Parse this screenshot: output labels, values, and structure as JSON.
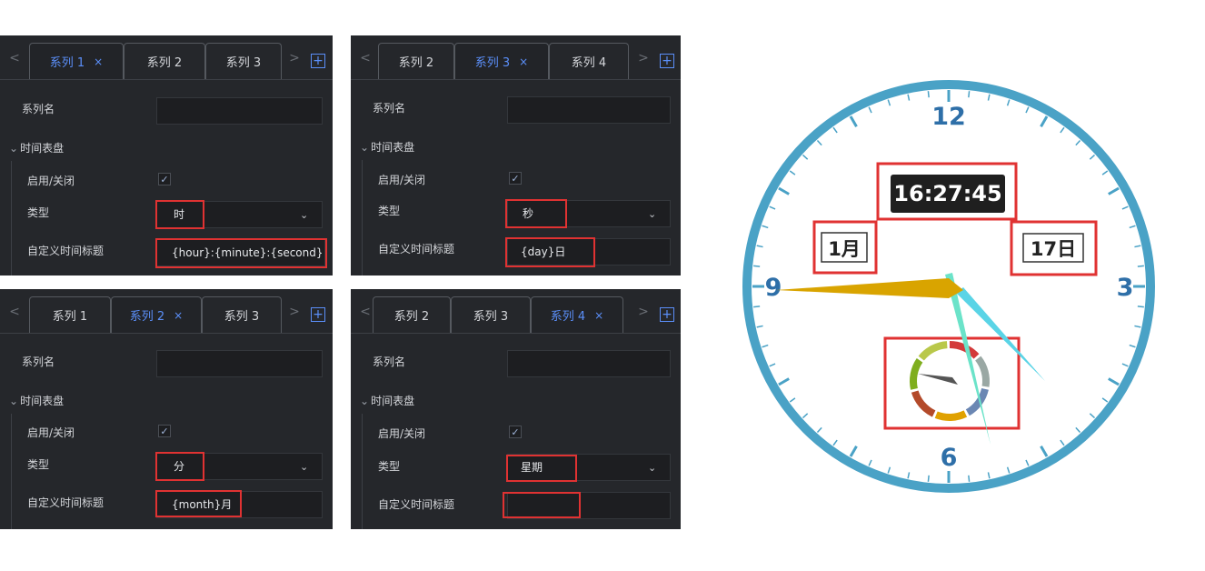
{
  "tab_labels": {
    "s1": "系列 1",
    "s2": "系列 2",
    "s3": "系列 3",
    "s4": "系列 4",
    "close": "×",
    "add": "+",
    "prev": "<",
    "next": ">"
  },
  "form_labels": {
    "series_name": "系列名",
    "section": "时间表盘",
    "enable": "启用/关闭",
    "type": "类型",
    "custom_title": "自定义时间标题",
    "checkmark": "✓",
    "select_chevron": "⌄",
    "section_chevron": "⌄"
  },
  "panels": {
    "p1": {
      "type_value": "时",
      "custom_title_value": "{hour}:{minute}:{second}"
    },
    "p2": {
      "type_value": "秒",
      "custom_title_value": "{day}日"
    },
    "p3": {
      "type_value": "分",
      "custom_title_value": "{month}月"
    },
    "p4": {
      "type_value": "星期",
      "custom_title_value": ""
    }
  },
  "clock": {
    "numbers": {
      "n12": "12",
      "n3": "3",
      "n6": "6",
      "n9": "9"
    },
    "digital_time": "16:27:45",
    "month_label": "1月",
    "day_label": "17日"
  },
  "colors": {
    "accent": "#5b8ff9",
    "panel_bg": "#25272b",
    "highlight_red": "#e03232",
    "clock_ring": "#4aa2c6",
    "clock_numbers": "#2e6fa8",
    "hour_hand": "#d9a400",
    "minute_hand": "#5ad4e6",
    "second_hand": "#6be3c9"
  }
}
